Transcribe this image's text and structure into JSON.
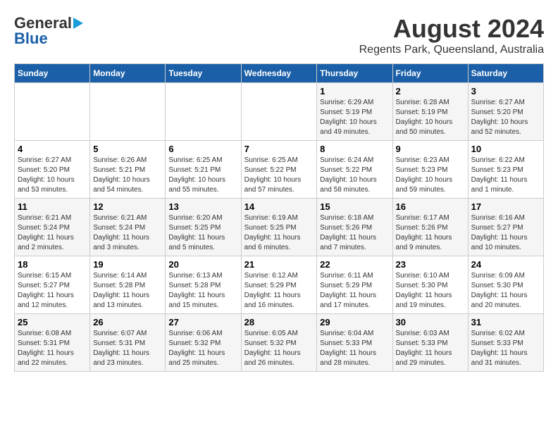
{
  "header": {
    "logo_line1": "General",
    "logo_line2": "Blue",
    "title": "August 2024",
    "subtitle": "Regents Park, Queensland, Australia"
  },
  "days_of_week": [
    "Sunday",
    "Monday",
    "Tuesday",
    "Wednesday",
    "Thursday",
    "Friday",
    "Saturday"
  ],
  "weeks": [
    [
      {
        "day": "",
        "info": ""
      },
      {
        "day": "",
        "info": ""
      },
      {
        "day": "",
        "info": ""
      },
      {
        "day": "",
        "info": ""
      },
      {
        "day": "1",
        "info": "Sunrise: 6:29 AM\nSunset: 5:19 PM\nDaylight: 10 hours\nand 49 minutes."
      },
      {
        "day": "2",
        "info": "Sunrise: 6:28 AM\nSunset: 5:19 PM\nDaylight: 10 hours\nand 50 minutes."
      },
      {
        "day": "3",
        "info": "Sunrise: 6:27 AM\nSunset: 5:20 PM\nDaylight: 10 hours\nand 52 minutes."
      }
    ],
    [
      {
        "day": "4",
        "info": "Sunrise: 6:27 AM\nSunset: 5:20 PM\nDaylight: 10 hours\nand 53 minutes."
      },
      {
        "day": "5",
        "info": "Sunrise: 6:26 AM\nSunset: 5:21 PM\nDaylight: 10 hours\nand 54 minutes."
      },
      {
        "day": "6",
        "info": "Sunrise: 6:25 AM\nSunset: 5:21 PM\nDaylight: 10 hours\nand 55 minutes."
      },
      {
        "day": "7",
        "info": "Sunrise: 6:25 AM\nSunset: 5:22 PM\nDaylight: 10 hours\nand 57 minutes."
      },
      {
        "day": "8",
        "info": "Sunrise: 6:24 AM\nSunset: 5:22 PM\nDaylight: 10 hours\nand 58 minutes."
      },
      {
        "day": "9",
        "info": "Sunrise: 6:23 AM\nSunset: 5:23 PM\nDaylight: 10 hours\nand 59 minutes."
      },
      {
        "day": "10",
        "info": "Sunrise: 6:22 AM\nSunset: 5:23 PM\nDaylight: 11 hours\nand 1 minute."
      }
    ],
    [
      {
        "day": "11",
        "info": "Sunrise: 6:21 AM\nSunset: 5:24 PM\nDaylight: 11 hours\nand 2 minutes."
      },
      {
        "day": "12",
        "info": "Sunrise: 6:21 AM\nSunset: 5:24 PM\nDaylight: 11 hours\nand 3 minutes."
      },
      {
        "day": "13",
        "info": "Sunrise: 6:20 AM\nSunset: 5:25 PM\nDaylight: 11 hours\nand 5 minutes."
      },
      {
        "day": "14",
        "info": "Sunrise: 6:19 AM\nSunset: 5:25 PM\nDaylight: 11 hours\nand 6 minutes."
      },
      {
        "day": "15",
        "info": "Sunrise: 6:18 AM\nSunset: 5:26 PM\nDaylight: 11 hours\nand 7 minutes."
      },
      {
        "day": "16",
        "info": "Sunrise: 6:17 AM\nSunset: 5:26 PM\nDaylight: 11 hours\nand 9 minutes."
      },
      {
        "day": "17",
        "info": "Sunrise: 6:16 AM\nSunset: 5:27 PM\nDaylight: 11 hours\nand 10 minutes."
      }
    ],
    [
      {
        "day": "18",
        "info": "Sunrise: 6:15 AM\nSunset: 5:27 PM\nDaylight: 11 hours\nand 12 minutes."
      },
      {
        "day": "19",
        "info": "Sunrise: 6:14 AM\nSunset: 5:28 PM\nDaylight: 11 hours\nand 13 minutes."
      },
      {
        "day": "20",
        "info": "Sunrise: 6:13 AM\nSunset: 5:28 PM\nDaylight: 11 hours\nand 15 minutes."
      },
      {
        "day": "21",
        "info": "Sunrise: 6:12 AM\nSunset: 5:29 PM\nDaylight: 11 hours\nand 16 minutes."
      },
      {
        "day": "22",
        "info": "Sunrise: 6:11 AM\nSunset: 5:29 PM\nDaylight: 11 hours\nand 17 minutes."
      },
      {
        "day": "23",
        "info": "Sunrise: 6:10 AM\nSunset: 5:30 PM\nDaylight: 11 hours\nand 19 minutes."
      },
      {
        "day": "24",
        "info": "Sunrise: 6:09 AM\nSunset: 5:30 PM\nDaylight: 11 hours\nand 20 minutes."
      }
    ],
    [
      {
        "day": "25",
        "info": "Sunrise: 6:08 AM\nSunset: 5:31 PM\nDaylight: 11 hours\nand 22 minutes."
      },
      {
        "day": "26",
        "info": "Sunrise: 6:07 AM\nSunset: 5:31 PM\nDaylight: 11 hours\nand 23 minutes."
      },
      {
        "day": "27",
        "info": "Sunrise: 6:06 AM\nSunset: 5:32 PM\nDaylight: 11 hours\nand 25 minutes."
      },
      {
        "day": "28",
        "info": "Sunrise: 6:05 AM\nSunset: 5:32 PM\nDaylight: 11 hours\nand 26 minutes."
      },
      {
        "day": "29",
        "info": "Sunrise: 6:04 AM\nSunset: 5:33 PM\nDaylight: 11 hours\nand 28 minutes."
      },
      {
        "day": "30",
        "info": "Sunrise: 6:03 AM\nSunset: 5:33 PM\nDaylight: 11 hours\nand 29 minutes."
      },
      {
        "day": "31",
        "info": "Sunrise: 6:02 AM\nSunset: 5:33 PM\nDaylight: 11 hours\nand 31 minutes."
      }
    ]
  ]
}
